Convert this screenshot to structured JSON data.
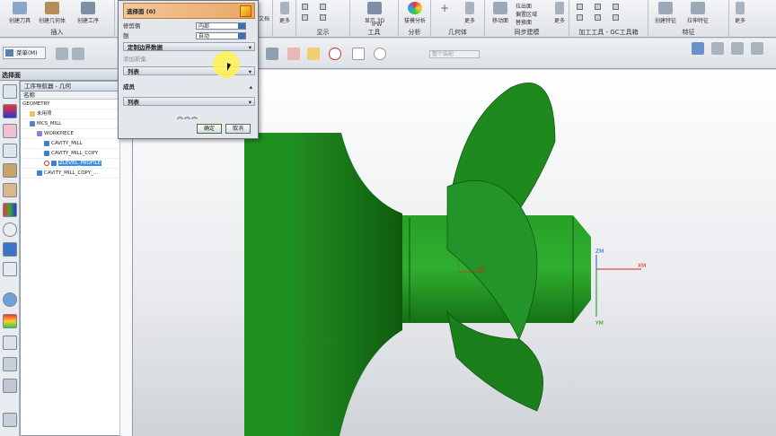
{
  "ribbon": {
    "top_labels": [
      "创建刀具",
      "创建几何体",
      "创建工序"
    ],
    "groups": [
      {
        "id": "insert",
        "caption": "插入"
      },
      {
        "id": "display",
        "caption": "显示"
      },
      {
        "id": "tool",
        "caption": "工具"
      },
      {
        "id": "analysis",
        "caption": "分析"
      },
      {
        "id": "geometry",
        "caption": "几何体"
      },
      {
        "id": "sync",
        "caption": "同步建模"
      },
      {
        "id": "toolbox",
        "caption": "加工工具 - GC工具箱"
      },
      {
        "id": "feature",
        "caption": "特征"
      }
    ],
    "buttons": {
      "more1": "更多",
      "document": "文档",
      "display3d": "显示 3D",
      "ipw": "IPW",
      "shape_analysis": "拔模分析",
      "more2": "更多",
      "move_face": "移动面",
      "pull_face": "拉出面",
      "offset_region": "偏置区域",
      "replace_face": "替换面",
      "more3": "更多",
      "create_feature": "创建特征",
      "pull_boss": "拉伸特征",
      "more4": "更多"
    }
  },
  "toolbar2": {
    "menu_label": "菜单(M)",
    "filter_label": "整个装配"
  },
  "panel_label": "选择面",
  "dialog": {
    "select_face": "选择面 (0)",
    "trim_side_label": "修剪侧",
    "trim_side_value": "内部",
    "plane_label": "刨",
    "plane_value": "自动",
    "custom_boundary": "定制边界数据",
    "add_new_set": "添加新集",
    "list1": "列表",
    "members": "成员",
    "list2": "列表",
    "ok": "确定",
    "cancel": "取消"
  },
  "navigator": {
    "title": "工序导航器 - 几何",
    "col_name": "名称",
    "rows": [
      {
        "label": "GEOMETRY",
        "indent": 0,
        "icon": "none",
        "status": "",
        "selected": false
      },
      {
        "label": "未用项",
        "indent": 1,
        "icon": "folder",
        "status": "",
        "selected": false
      },
      {
        "label": "MCS_MILL",
        "indent": 1,
        "icon": "mcs",
        "status": "",
        "selected": false
      },
      {
        "label": "WORKPIECE",
        "indent": 2,
        "icon": "workpiece",
        "status": "",
        "selected": false
      },
      {
        "label": "CAVITY_MILL",
        "indent": 3,
        "icon": "op",
        "status": "check",
        "selected": false
      },
      {
        "label": "CAVITY_MILL_COPY",
        "indent": 3,
        "icon": "op",
        "status": "check",
        "selected": false
      },
      {
        "label": "ZLEVEL_PROFILE",
        "indent": 3,
        "icon": "op-error",
        "status": "x",
        "selected": true
      },
      {
        "label": "CAVITY_MILL_COPY_...",
        "indent": 2,
        "icon": "op",
        "status": "check",
        "selected": false
      }
    ]
  },
  "viewport": {
    "axis_labels": {
      "xm": "XM",
      "ym": "YM",
      "zm": "ZM",
      "yc": "YC",
      "xc": "XC"
    },
    "model_color": "#1e8a1e"
  },
  "colors": {
    "accent_orange": "#e9a766",
    "selection_blue": "#3d8fe0",
    "check_green": "#1b9b2a"
  }
}
